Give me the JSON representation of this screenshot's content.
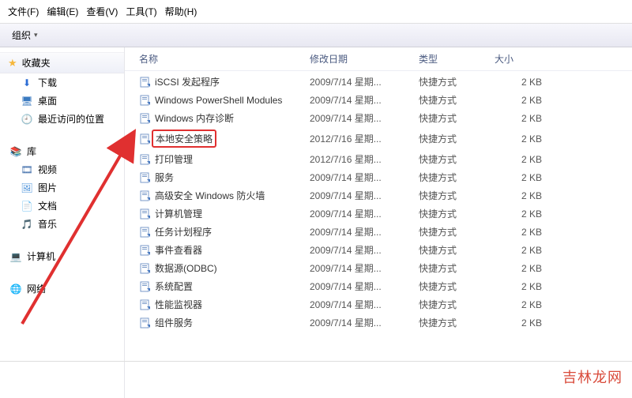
{
  "menu": {
    "file": "文件(F)",
    "edit": "编辑(E)",
    "view": "查看(V)",
    "tools": "工具(T)",
    "help": "帮助(H)"
  },
  "toolbar": {
    "organize": "组织"
  },
  "sidebar": {
    "favorites": "收藏夹",
    "downloads": "下载",
    "desktop": "桌面",
    "recent": "最近访问的位置",
    "libraries": "库",
    "videos": "视频",
    "pictures": "图片",
    "documents": "文档",
    "music": "音乐",
    "computer": "计算机",
    "network": "网络"
  },
  "columns": {
    "name": "名称",
    "date": "修改日期",
    "type": "类型",
    "size": "大小"
  },
  "files": [
    {
      "name": "iSCSI 发起程序",
      "date": "2009/7/14 星期...",
      "type": "快捷方式",
      "size": "2 KB",
      "highlighted": false
    },
    {
      "name": "Windows PowerShell Modules",
      "date": "2009/7/14 星期...",
      "type": "快捷方式",
      "size": "2 KB",
      "highlighted": false
    },
    {
      "name": "Windows 内存诊断",
      "date": "2009/7/14 星期...",
      "type": "快捷方式",
      "size": "2 KB",
      "highlighted": false
    },
    {
      "name": "本地安全策略",
      "date": "2012/7/16 星期...",
      "type": "快捷方式",
      "size": "2 KB",
      "highlighted": true
    },
    {
      "name": "打印管理",
      "date": "2012/7/16 星期...",
      "type": "快捷方式",
      "size": "2 KB",
      "highlighted": false
    },
    {
      "name": "服务",
      "date": "2009/7/14 星期...",
      "type": "快捷方式",
      "size": "2 KB",
      "highlighted": false
    },
    {
      "name": "高级安全 Windows 防火墙",
      "date": "2009/7/14 星期...",
      "type": "快捷方式",
      "size": "2 KB",
      "highlighted": false
    },
    {
      "name": "计算机管理",
      "date": "2009/7/14 星期...",
      "type": "快捷方式",
      "size": "2 KB",
      "highlighted": false
    },
    {
      "name": "任务计划程序",
      "date": "2009/7/14 星期...",
      "type": "快捷方式",
      "size": "2 KB",
      "highlighted": false
    },
    {
      "name": "事件查看器",
      "date": "2009/7/14 星期...",
      "type": "快捷方式",
      "size": "2 KB",
      "highlighted": false
    },
    {
      "name": "数据源(ODBC)",
      "date": "2009/7/14 星期...",
      "type": "快捷方式",
      "size": "2 KB",
      "highlighted": false
    },
    {
      "name": "系统配置",
      "date": "2009/7/14 星期...",
      "type": "快捷方式",
      "size": "2 KB",
      "highlighted": false
    },
    {
      "name": "性能监视器",
      "date": "2009/7/14 星期...",
      "type": "快捷方式",
      "size": "2 KB",
      "highlighted": false
    },
    {
      "name": "组件服务",
      "date": "2009/7/14 星期...",
      "type": "快捷方式",
      "size": "2 KB",
      "highlighted": false
    }
  ],
  "watermark": "吉林龙网"
}
